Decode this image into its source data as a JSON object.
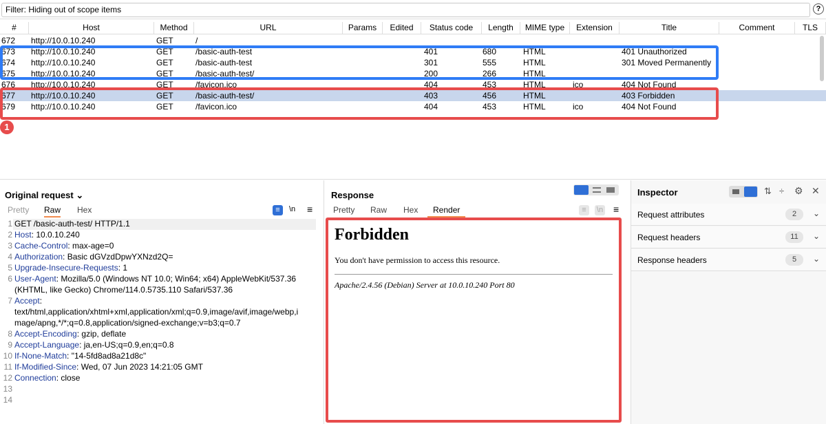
{
  "filter": {
    "text": "Filter: Hiding out of scope items",
    "help": "?"
  },
  "history": {
    "columns": [
      "#",
      "Host",
      "Method",
      "URL",
      "Params",
      "Edited",
      "Status code",
      "Length",
      "MIME type",
      "Extension",
      "Title",
      "Comment",
      "TLS"
    ],
    "rows": [
      {
        "id": "672",
        "host": "http://10.0.10.240",
        "method": "GET",
        "url": "/",
        "status": "",
        "length": "",
        "mime": "",
        "ext": "",
        "title": ""
      },
      {
        "id": "673",
        "host": "http://10.0.10.240",
        "method": "GET",
        "url": "/basic-auth-test",
        "status": "401",
        "length": "680",
        "mime": "HTML",
        "ext": "",
        "title": "401 Unauthorized"
      },
      {
        "id": "674",
        "host": "http://10.0.10.240",
        "method": "GET",
        "url": "/basic-auth-test",
        "status": "301",
        "length": "555",
        "mime": "HTML",
        "ext": "",
        "title": "301 Moved Permanently"
      },
      {
        "id": "675",
        "host": "http://10.0.10.240",
        "method": "GET",
        "url": "/basic-auth-test/",
        "status": "200",
        "length": "266",
        "mime": "HTML",
        "ext": "",
        "title": ""
      },
      {
        "id": "676",
        "host": "http://10.0.10.240",
        "method": "GET",
        "url": "/favicon.ico",
        "status": "404",
        "length": "453",
        "mime": "HTML",
        "ext": "ico",
        "title": "404 Not Found"
      },
      {
        "id": "677",
        "host": "http://10.0.10.240",
        "method": "GET",
        "url": "/basic-auth-test/",
        "status": "403",
        "length": "456",
        "mime": "HTML",
        "ext": "",
        "title": "403 Forbidden"
      },
      {
        "id": "679",
        "host": "http://10.0.10.240",
        "method": "GET",
        "url": "/favicon.ico",
        "status": "404",
        "length": "453",
        "mime": "HTML",
        "ext": "ico",
        "title": "404 Not Found"
      }
    ],
    "badge": "1"
  },
  "request": {
    "title": "Original request",
    "tabs": [
      "Pretty",
      "Raw",
      "Hex"
    ],
    "newline_label": "\\n",
    "menu_label": "≡",
    "lines": [
      {
        "n": "1",
        "k": "",
        "v": "GET /basic-auth-test/ HTTP/1.1"
      },
      {
        "n": "2",
        "k": "Host",
        "v": ": 10.0.10.240"
      },
      {
        "n": "3",
        "k": "Cache-Control",
        "v": ": max-age=0"
      },
      {
        "n": "4",
        "k": "Authorization",
        "v": ": Basic dGVzdDpwYXNzd2Q="
      },
      {
        "n": "5",
        "k": "Upgrade-Insecure-Requests",
        "v": ": 1"
      },
      {
        "n": "6",
        "k": "User-Agent",
        "v": ": Mozilla/5.0 (Windows NT 10.0; Win64; x64) AppleWebKit/537.36"
      },
      {
        "n": "",
        "k": "",
        "v": "(KHTML, like Gecko) Chrome/114.0.5735.110 Safari/537.36"
      },
      {
        "n": "7",
        "k": "Accept",
        "v": ":"
      },
      {
        "n": "",
        "k": "",
        "v": "text/html,application/xhtml+xml,application/xml;q=0.9,image/avif,image/webp,i"
      },
      {
        "n": "",
        "k": "",
        "v": "mage/apng,*/*;q=0.8,application/signed-exchange;v=b3;q=0.7"
      },
      {
        "n": "8",
        "k": "Accept-Encoding",
        "v": ": gzip, deflate"
      },
      {
        "n": "9",
        "k": "Accept-Language",
        "v": ": ja,en-US;q=0.9,en;q=0.8"
      },
      {
        "n": "10",
        "k": "If-None-Match",
        "v": ": \"14-5fd8ad8a21d8c\""
      },
      {
        "n": "11",
        "k": "If-Modified-Since",
        "v": ": Wed, 07 Jun 2023 14:21:05 GMT"
      },
      {
        "n": "12",
        "k": "Connection",
        "v": ": close"
      },
      {
        "n": "13",
        "k": "",
        "v": ""
      },
      {
        "n": "14",
        "k": "",
        "v": ""
      }
    ]
  },
  "response": {
    "title": "Response",
    "tabs": [
      "Pretty",
      "Raw",
      "Hex",
      "Render"
    ],
    "newline_label": "\\n",
    "menu_label": "≡",
    "render": {
      "heading": "Forbidden",
      "message": "You don't have permission to access this resource.",
      "server": "Apache/2.4.56 (Debian) Server at 10.0.10.240 Port 80"
    }
  },
  "inspector": {
    "title": "Inspector",
    "close": "✕",
    "sections": [
      {
        "label": "Request attributes",
        "count": "2"
      },
      {
        "label": "Request headers",
        "count": "11"
      },
      {
        "label": "Response headers",
        "count": "5"
      }
    ]
  },
  "colors": {
    "accent_orange": "#f18b4e",
    "highlight_blue": "#2f7cf6",
    "highlight_red": "#e74c4c",
    "selected_row": "#c8d6ec",
    "header_key": "#1f3c9a"
  }
}
